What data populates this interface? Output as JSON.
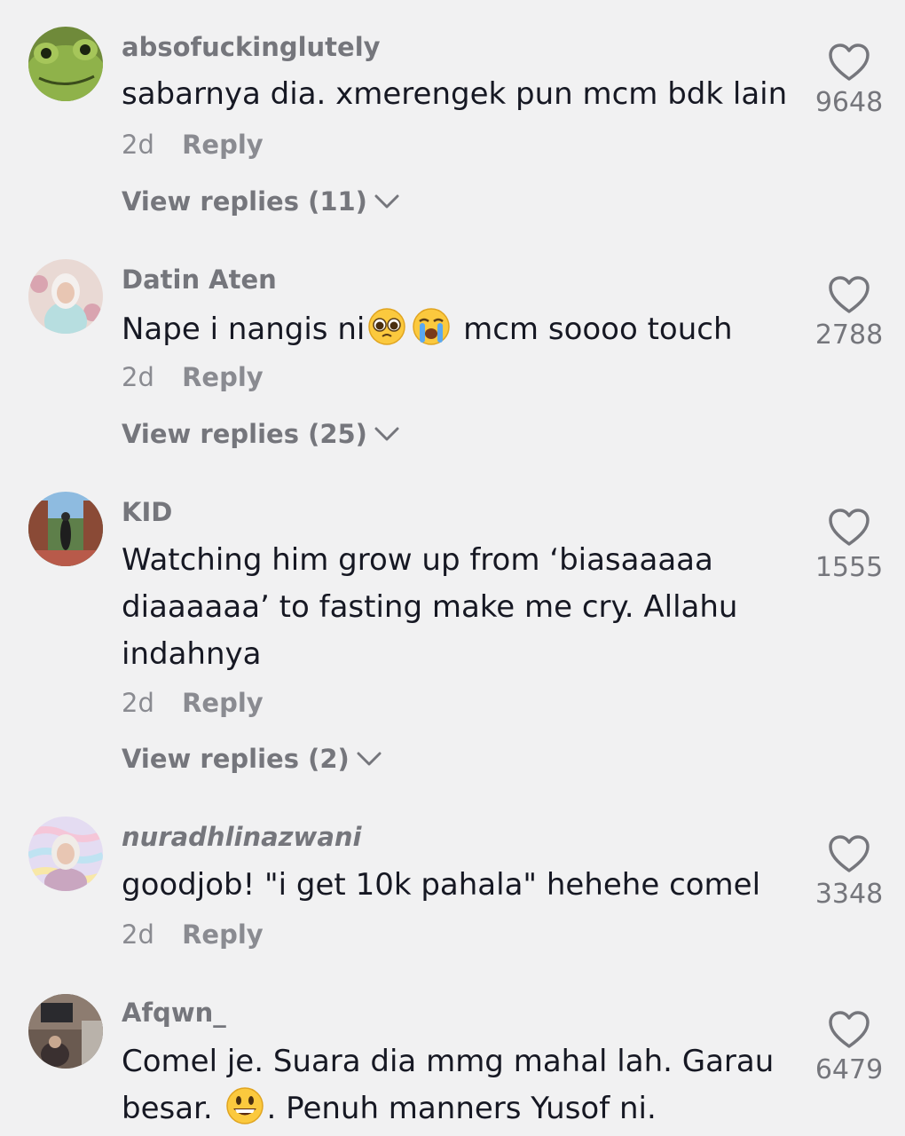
{
  "comments": [
    {
      "username": "absofuckinglutely",
      "text": "sabarnya dia. xmerengek pun mcm bdk lain",
      "time": "2d",
      "reply": "Reply",
      "view_replies": "View replies (11)",
      "likes": "9648"
    },
    {
      "username": "Datin Aten",
      "text_before": "Nape i nangis ni",
      "text_after": " mcm soooo touch",
      "emojis": [
        "pleading-face-emoji",
        "loudly-crying-face-emoji"
      ],
      "time": "2d",
      "reply": "Reply",
      "view_replies": "View replies (25)",
      "likes": "2788"
    },
    {
      "username": "KID",
      "text": "Watching him grow up from ‘biasaaaaa diaaaaaa’ to fasting make me cry. Allahu indahnya",
      "time": "2d",
      "reply": "Reply",
      "view_replies": "View replies (2)",
      "likes": "1555"
    },
    {
      "username": "nuradhlinazwani",
      "text": "goodjob! \"i get 10k pahala\" hehehe comel",
      "time": "2d",
      "reply": "Reply",
      "likes": "3348"
    },
    {
      "username": "Afqwn_",
      "text_before": "Comel je. Suara dia mmg mahal lah. Garau besar. ",
      "text_after": ". Penuh manners Yusof ni.",
      "emojis": [
        "grinning-face-emoji"
      ],
      "likes": "6479"
    }
  ],
  "colors": {
    "background": "#f1f1f2",
    "text": "#161823",
    "muted": "#8a8b91"
  }
}
